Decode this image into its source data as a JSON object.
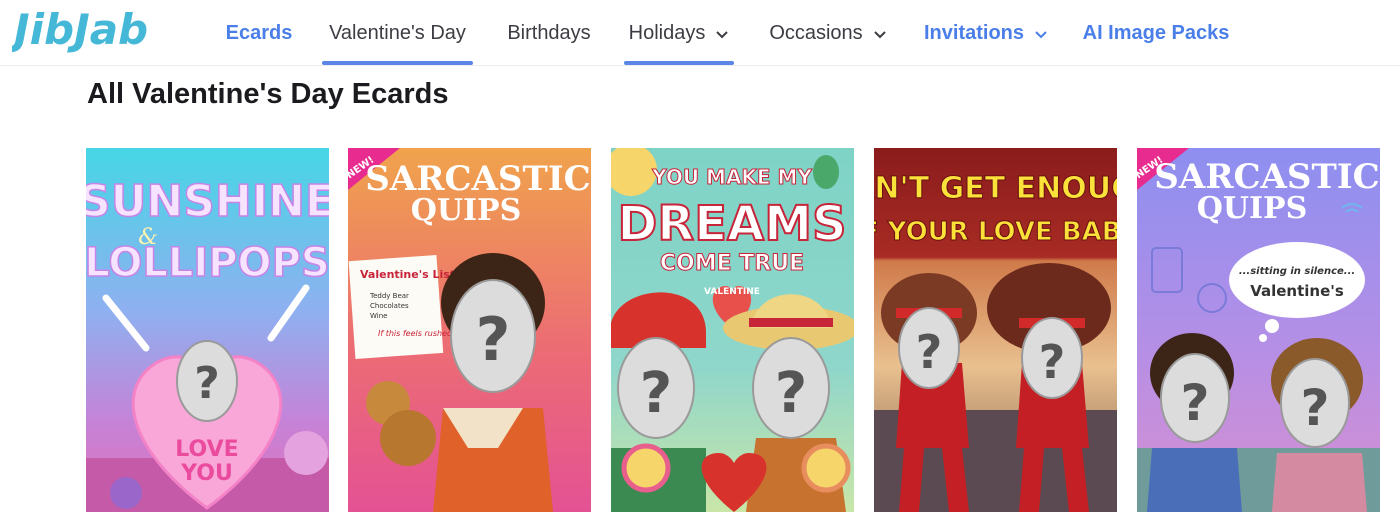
{
  "brand": {
    "name": "JibJab"
  },
  "nav": {
    "items": [
      {
        "label": "Ecards"
      },
      {
        "label": "Valentine's Day"
      },
      {
        "label": "Birthdays"
      },
      {
        "label": "Holidays"
      },
      {
        "label": "Occasions"
      },
      {
        "label": "Invitations"
      },
      {
        "label": "AI Image Packs"
      }
    ]
  },
  "page": {
    "title": "All Valentine's Day Ecards"
  },
  "cards": [
    {
      "line1": "SUNSHINE",
      "line2": "&",
      "line3": "LOLLIPOPS",
      "heart_text1": "LOVE",
      "heart_text2": "YOU"
    },
    {
      "badge": "NEW!",
      "line1": "SARCASTIC",
      "line2": "QUIPS",
      "note_title": "Valentine's List",
      "note_items": [
        "Teddy Bear",
        "Chocolates",
        "Wine"
      ],
      "note_footer": "If this feels rushed ..."
    },
    {
      "line1": "YOU MAKE MY",
      "line2": "DREAMS",
      "line3": "COME TRUE",
      "tag": "VALENTINE"
    },
    {
      "line1": "CAN'T GET ENOUGH",
      "line2": "OF YOUR LOVE BABE!"
    },
    {
      "badge": "NEW!",
      "line1": "SARCASTIC",
      "line2": "QUIPS",
      "bubble1": "...sitting in silence...",
      "bubble2": "Valentine's"
    }
  ],
  "colors": {
    "accent": "#4a7ee8",
    "underline": "#5b86e8",
    "logo": "#45b8d8"
  }
}
